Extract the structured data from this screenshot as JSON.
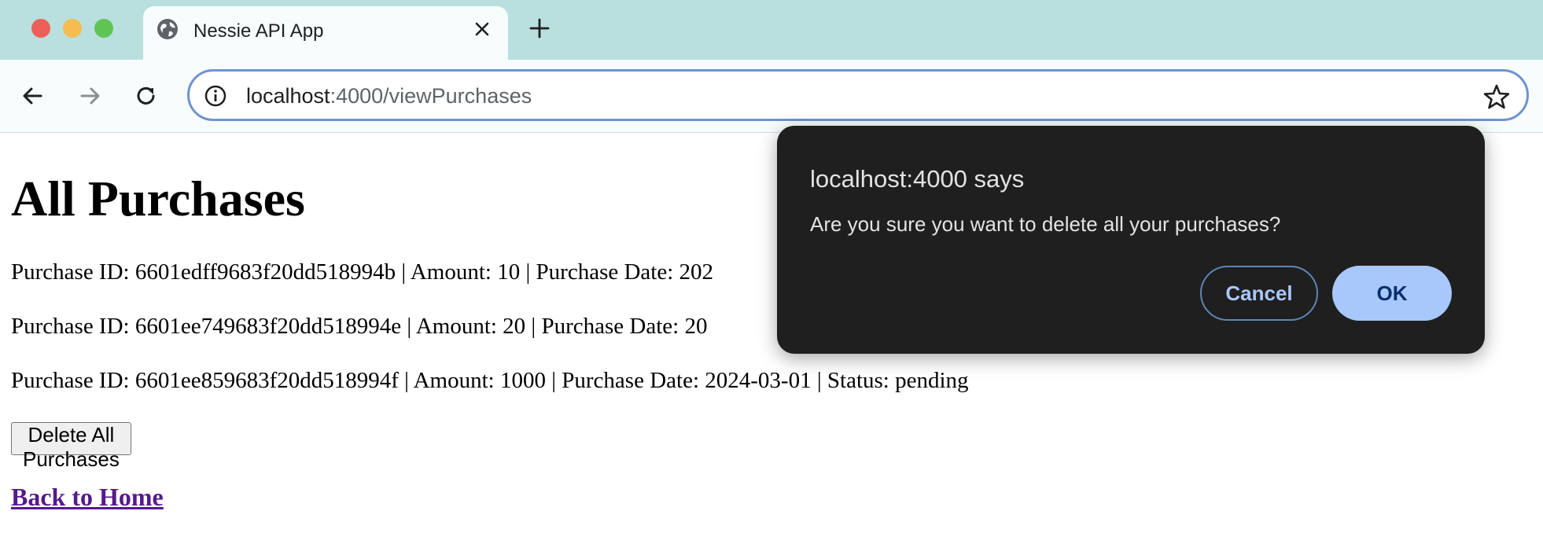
{
  "browser": {
    "tab_title": "Nessie API App",
    "new_tab_label": "+",
    "url_host": "localhost",
    "url_path": ":4000/viewPurchases"
  },
  "page": {
    "heading": "All Purchases",
    "purchases": [
      "Purchase ID: 6601edff9683f20dd518994b | Amount: 10 | Purchase Date: 202",
      "Purchase ID: 6601ee749683f20dd518994e | Amount: 20 | Purchase Date: 20",
      "Purchase ID: 6601ee859683f20dd518994f | Amount: 1000 | Purchase Date: 2024-03-01 | Status: pending"
    ],
    "delete_button": "Delete All Purchases",
    "back_link": "Back to Home"
  },
  "dialog": {
    "title": "localhost:4000 says",
    "message": "Are you sure you want to delete all your purchases?",
    "cancel_label": "Cancel",
    "ok_label": "OK"
  },
  "icons": {
    "window_close": "red-close-icon",
    "window_minimize": "yellow-minimize-icon",
    "window_zoom": "green-zoom-icon",
    "tab_favicon": "globe-icon",
    "tab_close": "close-icon",
    "new_tab": "plus-icon",
    "back": "arrow-left-icon",
    "forward": "arrow-right-icon",
    "reload": "reload-icon",
    "site_info": "info-icon",
    "bookmark": "star-icon"
  },
  "colors": {
    "tabstrip": "#b9dfdf",
    "dialog_bg": "#1f1f1f",
    "ok_button": "#a8c7fa",
    "link_visited": "#551a8b"
  }
}
